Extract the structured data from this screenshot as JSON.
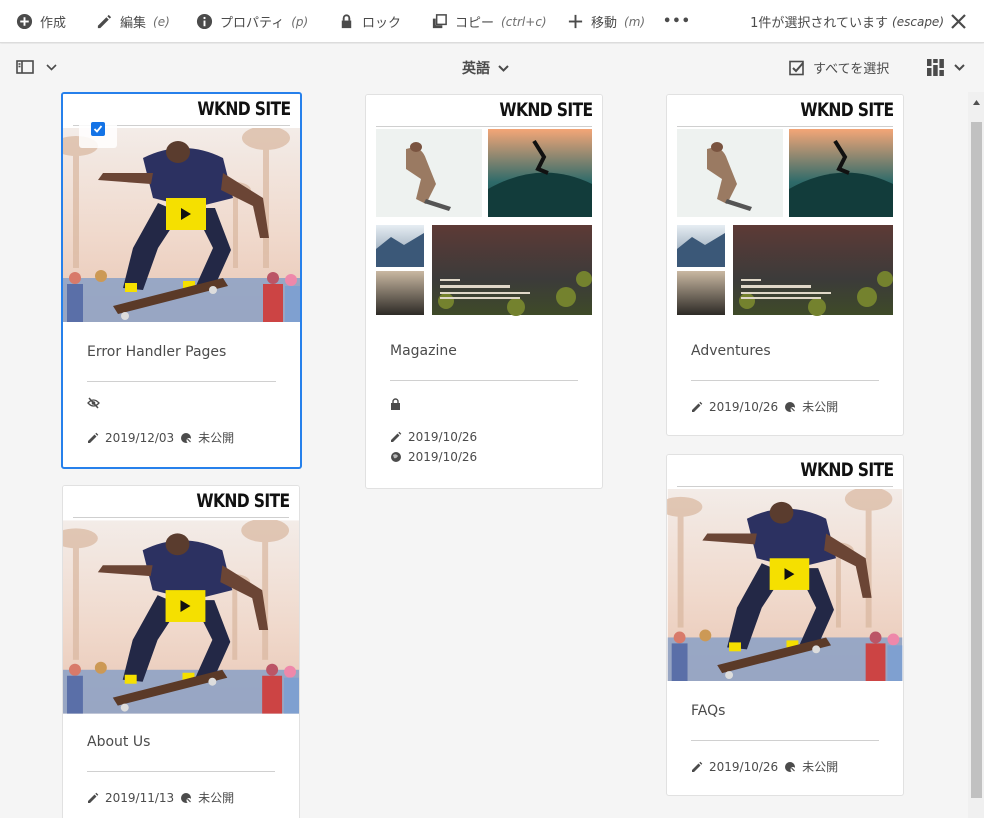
{
  "actionbar": {
    "create": {
      "label": "作成",
      "icon": "add-circle-icon"
    },
    "edit": {
      "label": "編集",
      "shortcut": "(e)",
      "icon": "pencil-icon"
    },
    "properties": {
      "label": "プロパティ",
      "shortcut": "(p)",
      "icon": "info-icon"
    },
    "lock": {
      "label": "ロック",
      "icon": "lock-icon"
    },
    "copy": {
      "label": "コピー",
      "shortcut": "(ctrl+c)",
      "icon": "copy-icon"
    },
    "move": {
      "label": "移動",
      "shortcut": "(m)",
      "icon": "move-icon"
    },
    "more": {
      "label": "•••",
      "icon": "more-icon"
    },
    "selection": {
      "text": "1件が選択されています",
      "shortcut": "(escape)"
    }
  },
  "toolbar": {
    "language": "英語",
    "select_all": "すべてを選択"
  },
  "cards": [
    {
      "brand": "WKND SITE",
      "title": "Error Handler Pages",
      "selected": true,
      "status_icon": "hidden-eye-icon",
      "modified": "2019/12/03",
      "published": "未公開",
      "thumbnail": "skater-video"
    },
    {
      "brand": "WKND SITE",
      "title": "Magazine",
      "selected": false,
      "status_icon": "lock-icon",
      "modified": "2019/10/26",
      "published": "2019/10/26",
      "thumbnail": "collage"
    },
    {
      "brand": "WKND SITE",
      "title": "Adventures",
      "selected": false,
      "modified": "2019/10/26",
      "published": "未公開",
      "thumbnail": "collage"
    },
    {
      "brand": "WKND SITE",
      "title": "About Us",
      "selected": false,
      "modified": "2019/11/13",
      "published": "未公開",
      "thumbnail": "skater-video"
    },
    {
      "brand": "WKND SITE",
      "title": "FAQs",
      "selected": false,
      "modified": "2019/10/26",
      "published": "未公開",
      "thumbnail": "skater-video"
    }
  ],
  "colors": {
    "accent": "#1473e6",
    "selected_border": "#2680eb",
    "play_badge": "#f5e000"
  }
}
